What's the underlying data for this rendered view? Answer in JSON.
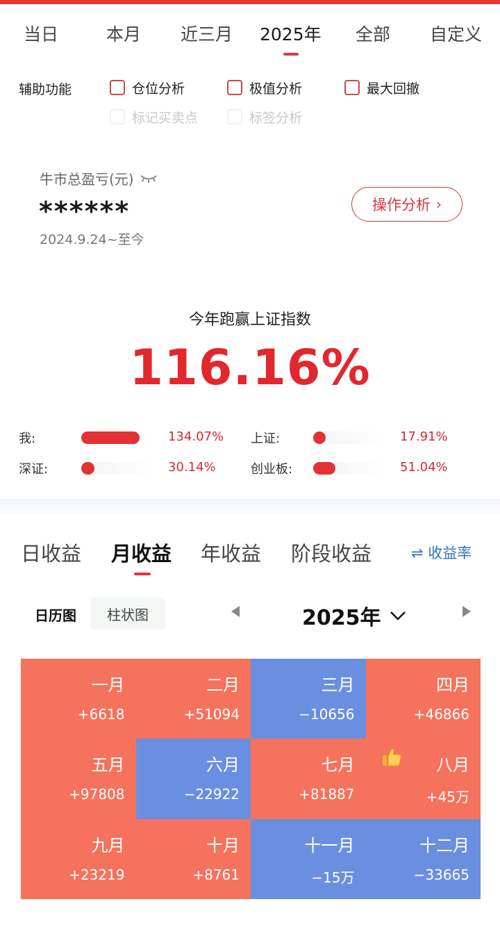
{
  "colors": {
    "accent": "#e8363a",
    "profit": "#f5725c",
    "loss": "#6b8fe0",
    "link": "#2f74c9"
  },
  "period_tabs": [
    {
      "label": "当日"
    },
    {
      "label": "本月"
    },
    {
      "label": "近三月"
    },
    {
      "label": "2025年",
      "active": true
    },
    {
      "label": "全部"
    },
    {
      "label": "自定义"
    }
  ],
  "aux": {
    "label": "辅助功能",
    "options": [
      {
        "label": "仓位分析",
        "checked": false,
        "enabled": true
      },
      {
        "label": "极值分析",
        "checked": false,
        "enabled": true
      },
      {
        "label": "最大回撤",
        "checked": false,
        "enabled": true
      },
      {
        "label": "标记买卖点",
        "checked": false,
        "enabled": false
      },
      {
        "label": "标签分析",
        "checked": false,
        "enabled": false
      }
    ]
  },
  "summary": {
    "label": "牛市总盈亏(元)",
    "visibility_icon": "eye-closed-icon",
    "value": "******",
    "date_range": "2024.9.24~至今",
    "button": "操作分析"
  },
  "beat": {
    "title": "今年跑赢上证指数",
    "value": "116.16%",
    "items": [
      {
        "label": "我:",
        "pct": "134.07%",
        "fill": 0.8
      },
      {
        "label": "上证:",
        "pct": "17.91%",
        "fill": 0.11
      },
      {
        "label": "深证:",
        "pct": "30.14%",
        "fill": 0.18
      },
      {
        "label": "创业板:",
        "pct": "51.04%",
        "fill": 0.3
      }
    ]
  },
  "earn_tabs": [
    {
      "label": "日收益"
    },
    {
      "label": "月收益",
      "active": true
    },
    {
      "label": "年收益"
    },
    {
      "label": "阶段收益"
    }
  ],
  "rate_link": "⇌ 收益率",
  "view": {
    "calendar": "日历图",
    "bar": "柱状图",
    "year": "2025年"
  },
  "months": [
    {
      "name": "一月",
      "value": "+6618",
      "type": "profit"
    },
    {
      "name": "二月",
      "value": "+51094",
      "type": "profit"
    },
    {
      "name": "三月",
      "value": "−10656",
      "type": "loss"
    },
    {
      "name": "四月",
      "value": "+46866",
      "type": "profit"
    },
    {
      "name": "五月",
      "value": "+97808",
      "type": "profit"
    },
    {
      "name": "六月",
      "value": "−22922",
      "type": "loss"
    },
    {
      "name": "七月",
      "value": "+81887",
      "type": "profit"
    },
    {
      "name": "八月",
      "value": "+45万",
      "type": "profit",
      "icon": "thumbs-up-icon"
    },
    {
      "name": "九月",
      "value": "+23219",
      "type": "profit"
    },
    {
      "name": "十月",
      "value": "+8761",
      "type": "profit"
    },
    {
      "name": "十一月",
      "value": "−15万",
      "type": "loss"
    },
    {
      "name": "十二月",
      "value": "−33665",
      "type": "loss"
    }
  ]
}
